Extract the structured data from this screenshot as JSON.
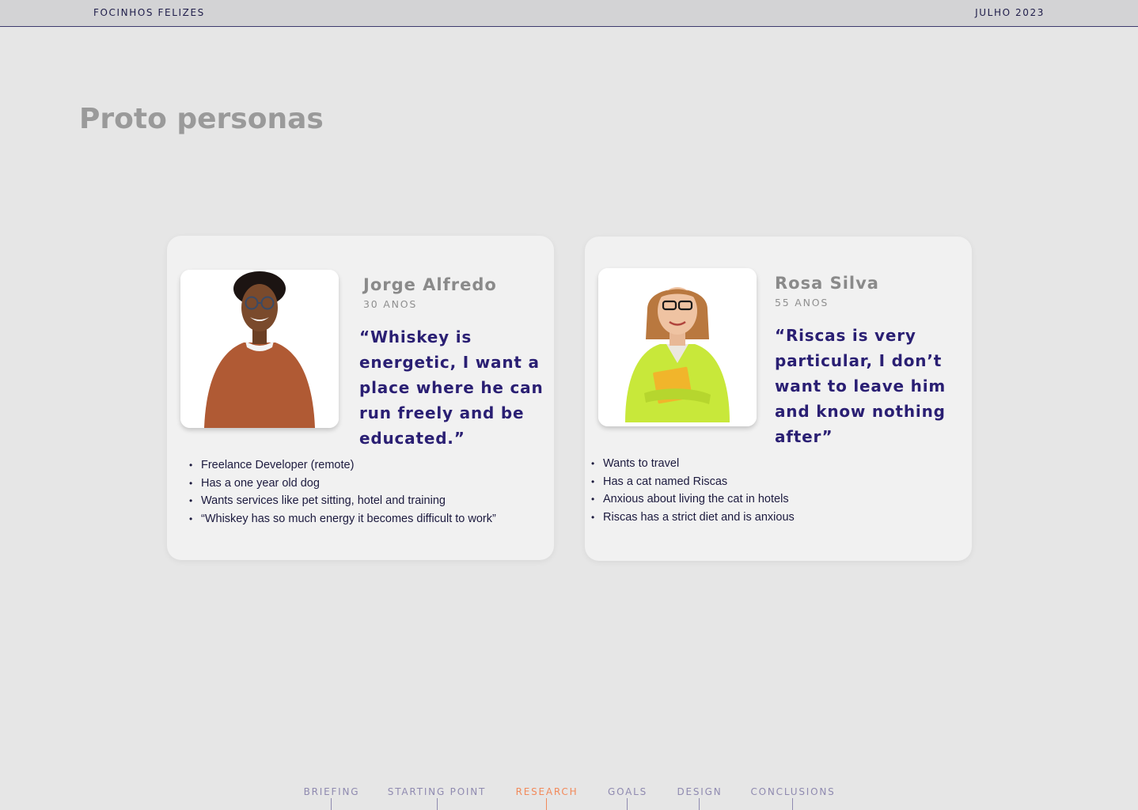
{
  "header": {
    "brand": "FOCINHOS FELIZES",
    "date": "JULHO 2023"
  },
  "page": {
    "title": "Proto personas"
  },
  "personas": [
    {
      "name": "Jorge Alfredo",
      "age": "30 ANOS",
      "quote": "“Whiskey is energetic, I want a place where he can run freely and be educated.”",
      "facts": [
        "Freelance Developer (remote)",
        "Has a one year old dog",
        "Wants services like pet sitting, hotel and training",
        "“Whiskey has so much energy it becomes difficult to work”"
      ]
    },
    {
      "name": "Rosa Silva",
      "age": "55 ANOS",
      "quote": "“Riscas is very particular, I don’t want to leave him and know nothing after”",
      "facts": [
        "Wants to travel",
        "Has a cat named Riscas",
        "Anxious about living the cat in hotels",
        "Riscas has a strict diet and is anxious"
      ]
    }
  ],
  "nav": {
    "items": [
      {
        "label": "BRIEFING",
        "active": false
      },
      {
        "label": "STARTING POINT",
        "active": false
      },
      {
        "label": "RESEARCH",
        "active": true
      },
      {
        "label": "GOALS",
        "active": false
      },
      {
        "label": "DESIGN",
        "active": false
      },
      {
        "label": "CONCLUSIONS",
        "active": false
      }
    ]
  },
  "colors": {
    "background": "#e6e6e6",
    "accent": "#2a1f73",
    "active_nav": "#f28a5b",
    "inactive_nav": "#8f8ab0"
  }
}
